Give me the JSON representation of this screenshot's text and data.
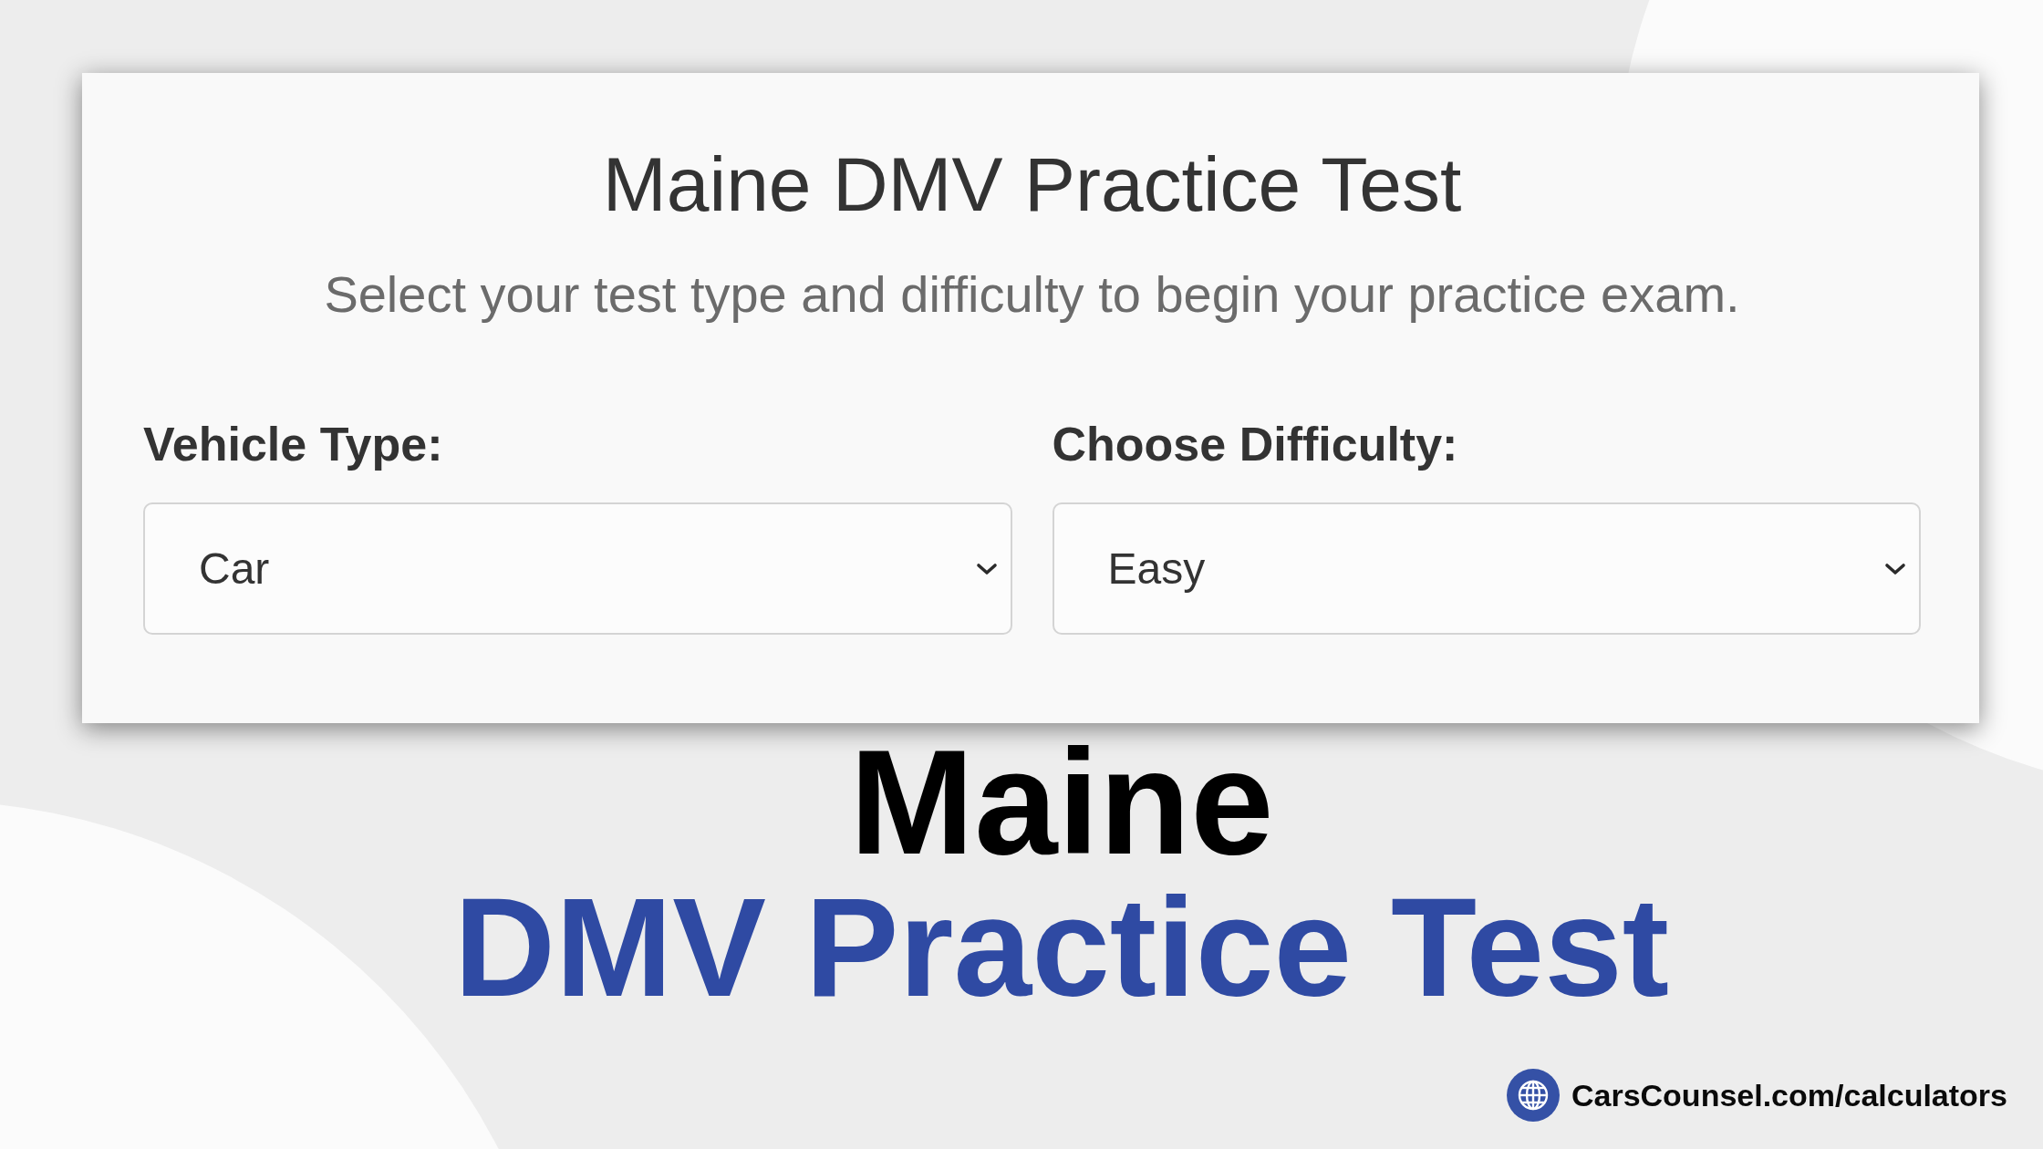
{
  "card": {
    "title": "Maine DMV Practice Test",
    "subtitle": "Select your test type and difficulty to begin your practice exam.",
    "fields": [
      {
        "label": "Vehicle Type:",
        "value": "Car"
      },
      {
        "label": "Choose Difficulty:",
        "value": "Easy"
      }
    ]
  },
  "headline": {
    "line_1": "Maine",
    "line_2": "DMV Practice Test"
  },
  "footer": {
    "link": "CarsCounsel.com/calculators"
  }
}
